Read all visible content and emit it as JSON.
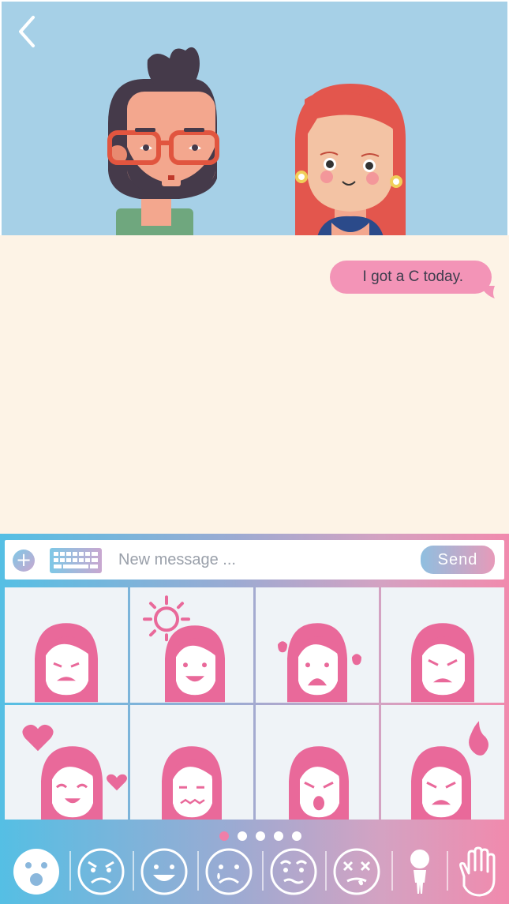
{
  "header": {
    "back_icon": "chevron-left-icon",
    "avatars": [
      "man-with-glasses-avatar",
      "red-haired-woman-avatar"
    ]
  },
  "chat": {
    "messages": [
      {
        "text": "I got a C today.",
        "from": "me"
      }
    ]
  },
  "composer": {
    "plus_label": "+",
    "placeholder": "New message ...",
    "value": "",
    "send_label": "Send"
  },
  "sticker_grid": {
    "stickers": [
      "annoyed-sticker",
      "sunny-sticker",
      "crying-sticker",
      "angry-sticker",
      "love-sticker",
      "worried-sticker",
      "shocked-sticker",
      "furious-sticker"
    ]
  },
  "pagination": {
    "pages": 5,
    "active": 1
  },
  "categories": [
    "surprised-face-icon",
    "angry-face-icon",
    "happy-face-icon",
    "sad-face-icon",
    "confused-face-icon",
    "dizzy-face-icon",
    "person-icon",
    "hand-icon"
  ],
  "colors": {
    "sky": "#a6d0e7",
    "chat_bg": "#fdf3e6",
    "bubble": "#f394b7",
    "sticker_pink": "#e9699a"
  }
}
